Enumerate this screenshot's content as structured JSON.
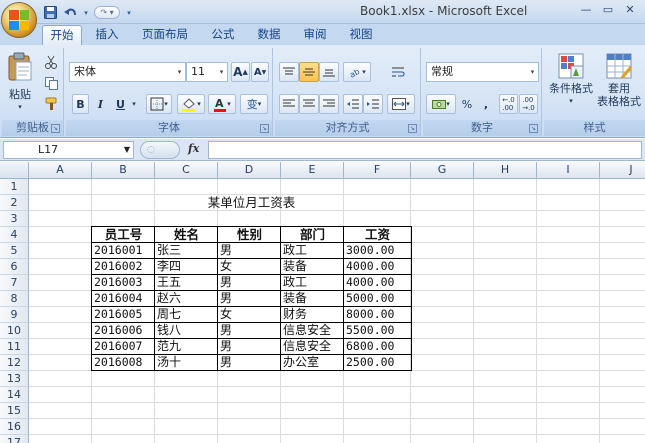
{
  "window": {
    "title": "Book1.xlsx - Microsoft Excel",
    "minimize": "—",
    "restore": "▭",
    "close": "✕"
  },
  "qat": {
    "save_icon": "save-icon",
    "undo_icon": "undo-icon",
    "redo_icon": "redo-icon"
  },
  "tabs": [
    "开始",
    "插入",
    "页面布局",
    "公式",
    "数据",
    "审阅",
    "视图"
  ],
  "ribbon": {
    "clipboard": {
      "label": "剪贴板",
      "paste": "粘贴"
    },
    "font": {
      "label": "字体",
      "family": "宋体",
      "size": "11",
      "bold": "B",
      "italic": "I",
      "underline": "U",
      "grow": "A",
      "shrink": "A",
      "wen": "变"
    },
    "alignment": {
      "label": "对齐方式"
    },
    "number": {
      "label": "数字",
      "format": "常规",
      "percent": "%",
      "comma": ","
    },
    "styles": {
      "label": "样式",
      "conditional": "条件格式",
      "table_format_1": "套用",
      "table_format_2": "表格格式"
    }
  },
  "formula_bar": {
    "name_box": "L17",
    "fx": "fx",
    "content": ""
  },
  "grid": {
    "columns": [
      "A",
      "B",
      "C",
      "D",
      "E",
      "F",
      "G",
      "H",
      "I",
      "J"
    ],
    "rows": [
      "1",
      "2",
      "3",
      "4",
      "5",
      "6",
      "7",
      "8",
      "9",
      "10",
      "11",
      "12",
      "13",
      "14",
      "15",
      "16",
      "17"
    ]
  },
  "sheet": {
    "title": "某单位月工资表",
    "headers": [
      "员工号",
      "姓名",
      "性别",
      "部门",
      "工资"
    ],
    "rows": [
      [
        "2016001",
        "张三",
        "男",
        "政工",
        "3000.00"
      ],
      [
        "2016002",
        "李四",
        "女",
        "装备",
        "4000.00"
      ],
      [
        "2016003",
        "王五",
        "男",
        "政工",
        "4000.00"
      ],
      [
        "2016004",
        "赵六",
        "男",
        "装备",
        "5000.00"
      ],
      [
        "2016005",
        "周七",
        "女",
        "财务",
        "8000.00"
      ],
      [
        "2016006",
        "钱八",
        "男",
        "信息安全",
        "5500.00"
      ],
      [
        "2016007",
        "范九",
        "男",
        "信息安全",
        "6800.00"
      ],
      [
        "2016008",
        "汤十",
        "男",
        "办公室",
        "2500.00"
      ]
    ]
  }
}
